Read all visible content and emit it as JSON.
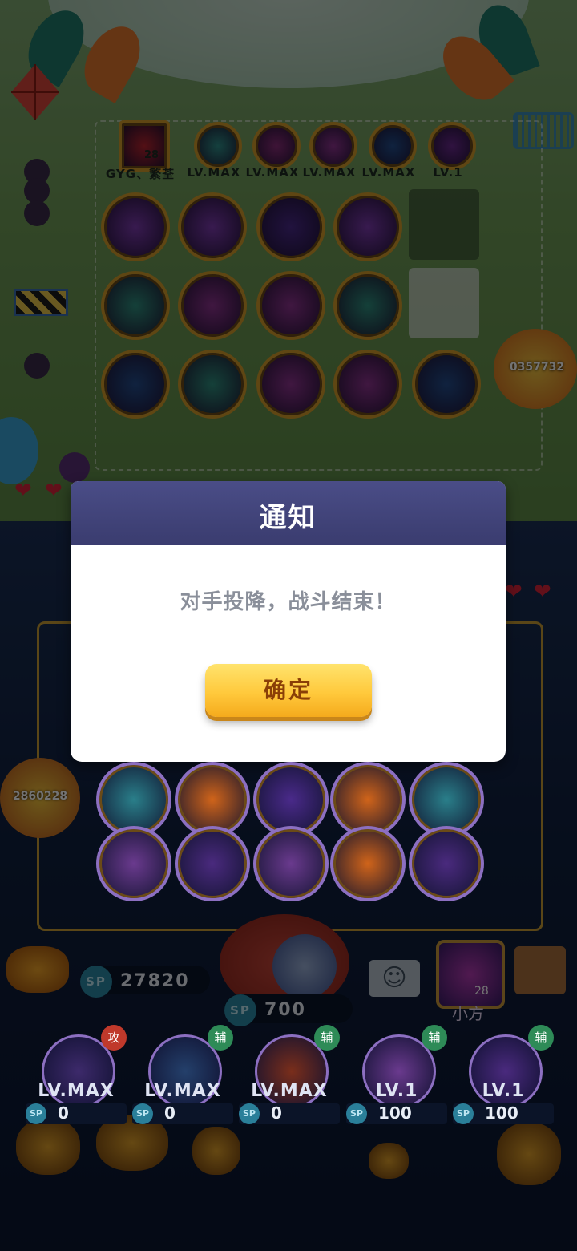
{
  "opponent": {
    "score": "0357732",
    "skills": [
      {
        "label": "GYG、繁荃",
        "level": "28",
        "color": "#b8242f"
      },
      {
        "label": "LV.MAX",
        "color": "#2f8f8a"
      },
      {
        "label": "LV.MAX",
        "color": "#8a2d7a"
      },
      {
        "label": "LV.MAX",
        "color": "#8e3490"
      },
      {
        "label": "LV.MAX",
        "color": "#244d8c"
      },
      {
        "label": "LV.1",
        "color": "#6a2a8e"
      }
    ]
  },
  "player": {
    "score": "2860228",
    "sp_total_badge": "SP",
    "sp_total": "27820",
    "sp_cost_badge": "SP",
    "sp_cost": "700",
    "name": "小方",
    "level": "28",
    "team": [
      {
        "level": "LV.MAX",
        "tag": "攻",
        "tag_color": "#c0392b",
        "sp_badge": "SP",
        "sp": "0",
        "color": "#3d2a6b"
      },
      {
        "level": "LV.MAX",
        "tag": "辅",
        "tag_color": "#2e8b57",
        "sp_badge": "SP",
        "sp": "0",
        "color": "#24406b"
      },
      {
        "level": "LV.MAX",
        "tag": "辅",
        "tag_color": "#2e8b57",
        "sp_badge": "SP",
        "sp": "0",
        "color": "#7a2e1b"
      },
      {
        "level": "LV.1",
        "tag": "辅",
        "tag_color": "#2e8b57",
        "sp_badge": "SP",
        "sp": "100",
        "color": "#6a3a8e"
      },
      {
        "level": "LV.1",
        "tag": "辅",
        "tag_color": "#2e8b57",
        "sp_badge": "SP",
        "sp": "100",
        "color": "#4a2a7e"
      }
    ]
  },
  "dialog": {
    "title": "通知",
    "message": "对手投降，战斗结束！",
    "confirm_label": "确定"
  },
  "colors": {
    "accent": "#4a4d87",
    "button": "#ffc93c",
    "button_text": "#8a3f07"
  }
}
